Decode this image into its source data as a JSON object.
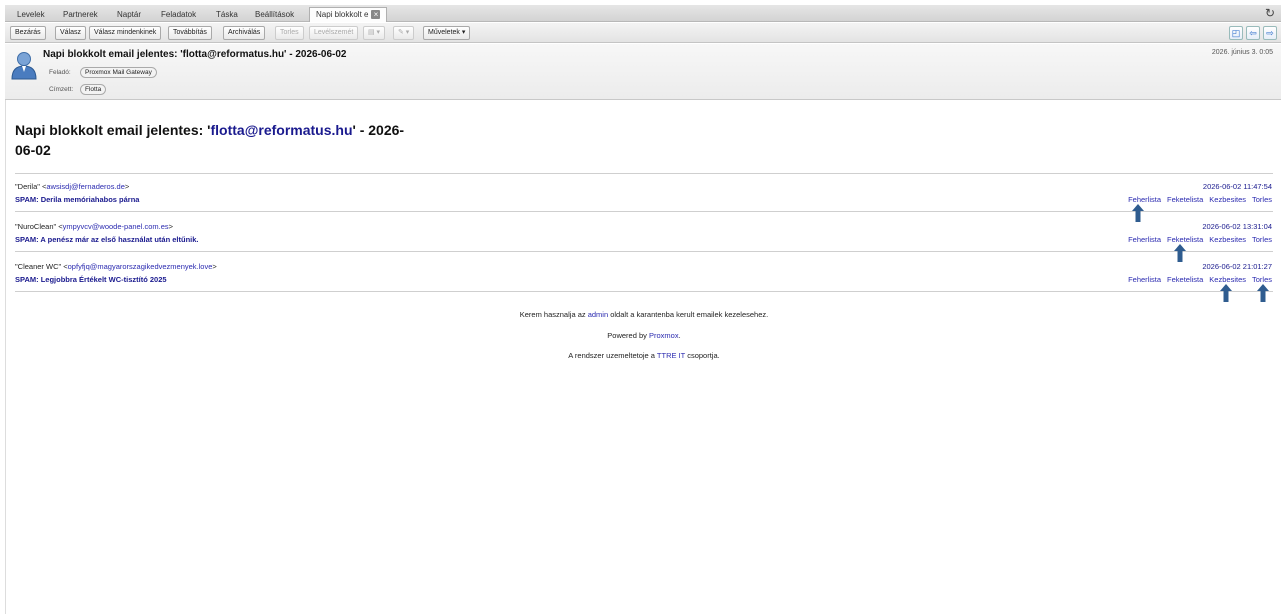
{
  "tabs": [
    {
      "label": "Levelek"
    },
    {
      "label": "Partnerek"
    },
    {
      "label": "Naptár"
    },
    {
      "label": "Feladatok"
    },
    {
      "label": "Táska"
    },
    {
      "label": "Beállítások"
    },
    {
      "label": "Napi blokkolt e",
      "active": true
    }
  ],
  "toolbar": {
    "close": "Bezárás",
    "reply": "Válasz",
    "reply_all": "Válasz mindenkinek",
    "forward": "Továbbítás",
    "archive": "Archiválás",
    "delete": "Torles",
    "junk": "Levélszemét",
    "actions": "Műveletek"
  },
  "header": {
    "subject": "Napi blokkolt email jelentes: 'flotta@reformatus.hu' - 2026-06-02",
    "date": "2026. június 3. 0:05",
    "from_label": "Feladó:",
    "from": "Proxmox Mail Gateway",
    "to_label": "Címzett:",
    "to": "Flotta"
  },
  "body": {
    "title_pre": "Napi blokkolt email jelentes: '",
    "title_link": "flotta@reformatus.hu",
    "title_post_1": "' - 2026-",
    "title_post_2": "06-02",
    "messages": [
      {
        "sender_name": "\"Derila\" <",
        "sender_addr": "awsisdj@fernaderos.de",
        "sender_end": ">",
        "subject": "SPAM: Derila memóriahabos párna",
        "time": "2026-06-02 11:47:54"
      },
      {
        "sender_name": "\"NuroClean\" <",
        "sender_addr": "ympyvcv@woode-panel.com.es",
        "sender_end": ">",
        "subject": "SPAM: A penész már az első használat után eltűnik.",
        "time": "2026-06-02 13:31:04"
      },
      {
        "sender_name": "\"Cleaner WC\" <",
        "sender_addr": "opfyfjq@magyarorszagikedvezmenyek.love",
        "sender_end": ">",
        "subject": "SPAM: Legjobbra Értékelt WC-tisztító 2025",
        "time": "2026-06-02 21:01:27"
      }
    ],
    "action_labels": {
      "whitelist": "Feherlista",
      "blacklist": "Feketelista",
      "deliver": "Kezbesites",
      "delete": "Torles"
    },
    "footer": {
      "line1_pre": "Kerem hasznalja az ",
      "line1_link": "admin",
      "line1_post": " oldalt a karantenba kerult emailek kezelesehez.",
      "line2_pre": "Powered by ",
      "line2_link": "Proxmox",
      "line2_post": ".",
      "line3_pre": "A rendszer uzemeltetoje a ",
      "line3_link": "TTRE IT",
      "line3_post": " csoportja."
    }
  },
  "colors": {
    "link": "#1a1a8e",
    "arrow": "#2f5c8f"
  }
}
